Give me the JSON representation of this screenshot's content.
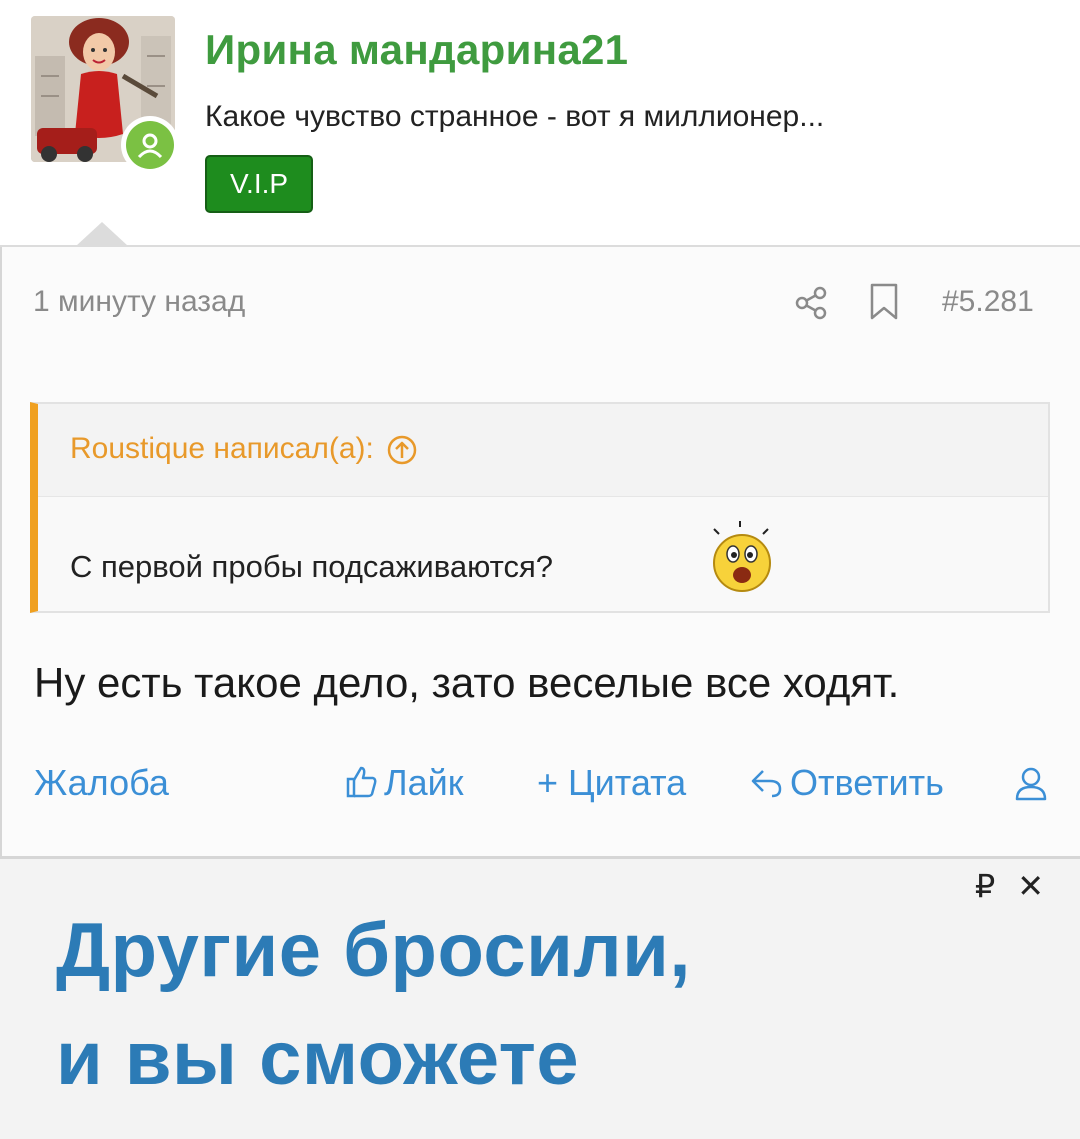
{
  "post": {
    "author": {
      "username": "Ирина мандарина21",
      "user_title": "Какое чувство странное - вот я миллионер...",
      "badge": "V.I.P",
      "online": true
    },
    "time_ago": "1 минуту назад",
    "post_number": "#5.281",
    "quote": {
      "author_line": "Roustique написал(а):",
      "text": "С первой пробы подсаживаются?",
      "emoji": "shocked-smiley"
    },
    "message": "Ну есть такое дело, зато веселые все ходят.",
    "actions": {
      "report": "Жалоба",
      "like": "Лайк",
      "quote": "+ Цитата",
      "reply": "Ответить"
    }
  },
  "ad": {
    "currency_symbol": "₽",
    "close_symbol": "✕",
    "headline_line1": "Другие бросили,",
    "headline_line2": "и вы сможете"
  },
  "colors": {
    "username": "#3f9b3f",
    "vip_badge": "#1e8c1e",
    "quote_accent": "#f0a020",
    "action_link": "#3b8fd6",
    "ad_headline": "#2c7bb6",
    "online_dot": "#7bc143"
  }
}
